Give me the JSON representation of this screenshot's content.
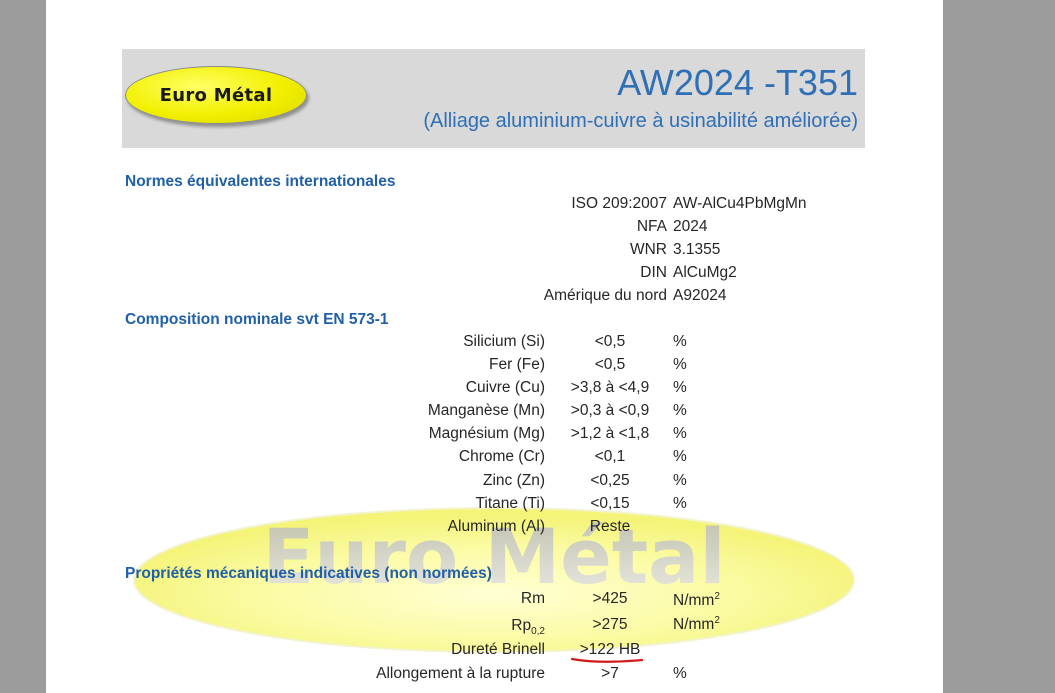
{
  "header": {
    "logo_text": "Euro Métal",
    "title": "AW2024 -T351",
    "subtitle": "(Alliage aluminium-cuivre à usinabilité améliorée)"
  },
  "watermark_text": "Euro Métal",
  "normes": {
    "heading": "Normes équivalentes internationales",
    "rows": [
      {
        "label": "ISO 209:2007",
        "value": "AW-AlCu4PbMgMn"
      },
      {
        "label": "NFA",
        "value": "2024"
      },
      {
        "label": "WNR",
        "value": "3.1355"
      },
      {
        "label": "DIN",
        "value": "AlCuMg2"
      },
      {
        "label": "Amérique du nord",
        "value": "A92024"
      }
    ]
  },
  "composition": {
    "heading": "Composition nominale svt EN 573-1",
    "rows": [
      {
        "label": "Silicium (Si)",
        "value": "<0,5",
        "unit": "%"
      },
      {
        "label": "Fer (Fe)",
        "value": "<0,5",
        "unit": "%"
      },
      {
        "label": "Cuivre (Cu)",
        "value": ">3,8 à <4,9",
        "unit": "%"
      },
      {
        "label": "Manganèse (Mn)",
        "value": ">0,3 à <0,9",
        "unit": "%"
      },
      {
        "label": "Magnésium (Mg)",
        "value": ">1,2 à <1,8",
        "unit": "%"
      },
      {
        "label": "Chrome (Cr)",
        "value": "<0,1",
        "unit": "%"
      },
      {
        "label": "Zinc (Zn)",
        "value": "<0,25",
        "unit": "%"
      },
      {
        "label": "Titane (Ti)",
        "value": "<0,15",
        "unit": "%"
      },
      {
        "label": "Aluminum (Al)",
        "value": "Reste",
        "unit": ""
      }
    ]
  },
  "mecanique": {
    "heading": "Propriétés mécaniques indicatives (non normées)",
    "rm": {
      "label": "Rm",
      "value": ">425",
      "unit": "N/mm",
      "unit_sup": "2"
    },
    "rp": {
      "label": "Rp",
      "label_sub": "0,2",
      "value": ">275",
      "unit": "N/mm",
      "unit_sup": "2"
    },
    "brinell": {
      "label": "Dureté Brinell",
      "value": ">122 HB"
    },
    "allongement": {
      "label": "Allongement à la rupture",
      "value": ">7",
      "unit": "%"
    }
  }
}
